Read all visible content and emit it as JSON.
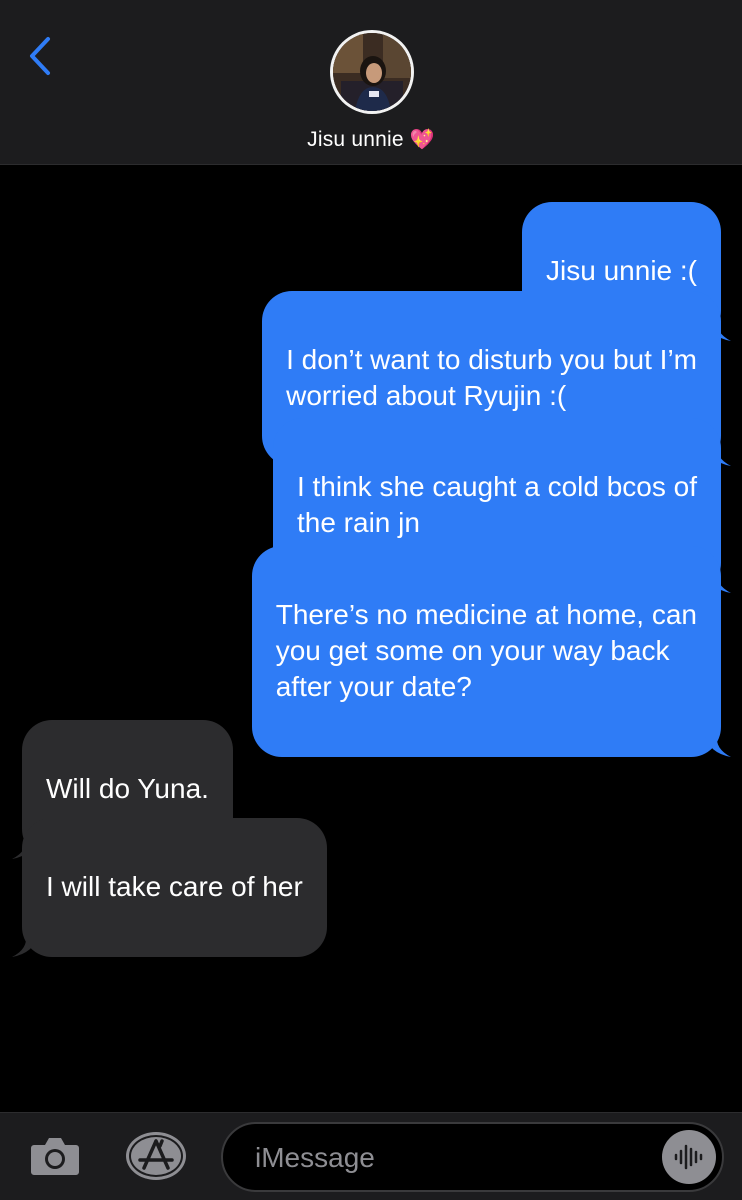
{
  "header": {
    "contact_name": "Jisu unnie",
    "contact_emoji": "💖",
    "back_icon": "chevron-left-icon"
  },
  "messages": [
    {
      "direction": "sent",
      "text": "Jisu unnie :("
    },
    {
      "direction": "sent",
      "text": "I don’t want to disturb you but I’m\nworried about Ryujin :("
    },
    {
      "direction": "sent",
      "text": "I think she caught a cold bcos of\nthe rain jn"
    },
    {
      "direction": "sent",
      "text": "There’s no medicine at home, can\nyou get some on your way back\nafter your date?"
    },
    {
      "direction": "received",
      "text": "Will do Yuna."
    },
    {
      "direction": "received",
      "text": "I will take care of her"
    }
  ],
  "input_bar": {
    "placeholder": "iMessage",
    "camera_icon": "camera-icon",
    "apps_icon": "app-store-icon",
    "audio_icon": "audio-waveform-icon"
  },
  "colors": {
    "sent_bubble": "#2f7cf6",
    "received_bubble": "#2c2c2e",
    "accent": "#2f7cf6",
    "background": "#000000",
    "bar": "#1c1c1e"
  }
}
